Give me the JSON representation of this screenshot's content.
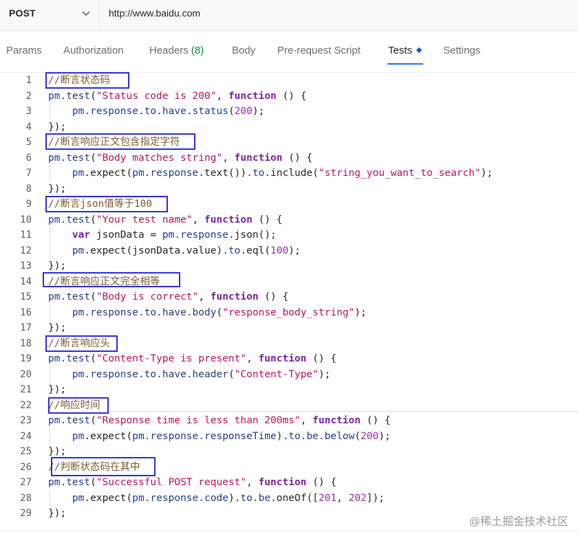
{
  "request": {
    "method": "POST",
    "url": "http://www.baidu.com"
  },
  "tabs": {
    "params": "Params",
    "authorization": "Authorization",
    "headers": "Headers",
    "headers_count": "(8)",
    "body": "Body",
    "pre_request": "Pre-request Script",
    "tests": "Tests",
    "settings": "Settings"
  },
  "code": {
    "lines": [
      "//断言状态码",
      "pm.test(\"Status code is 200\", function () {",
      "    pm.response.to.have.status(200);",
      "});",
      "//断言响应正文包含指定字符",
      "pm.test(\"Body matches string\", function () {",
      "    pm.expect(pm.response.text()).to.include(\"string_you_want_to_search\");",
      "});",
      "//断言json值等于100",
      "pm.test(\"Your test name\", function () {",
      "    var jsonData = pm.response.json();",
      "    pm.expect(jsonData.value).to.eql(100);",
      "});",
      "//断言响应正文完全相等",
      "pm.test(\"Body is correct\", function () {",
      "    pm.response.to.have.body(\"response_body_string\");",
      "});",
      "//断言响应头",
      "pm.test(\"Content-Type is present\", function () {",
      "    pm.response.to.have.header(\"Content-Type\");",
      "});",
      "//响应时间",
      "pm.test(\"Response time is less than 200ms\", function () {",
      "    pm.expect(pm.response.responseTime).to.be.below(200);",
      "});",
      "//判断状态码在其中",
      "pm.test(\"Successful POST request\", function () {",
      "    pm.expect(pm.response.code).to.be.oneOf([201, 202]);",
      "});"
    ]
  },
  "watermark": "@稀土掘金技术社区",
  "colors": {
    "annotation_box": "#2a2ad6",
    "active_tab_underline": "#1f6fe6",
    "headers_count": "#0a8a3e"
  }
}
